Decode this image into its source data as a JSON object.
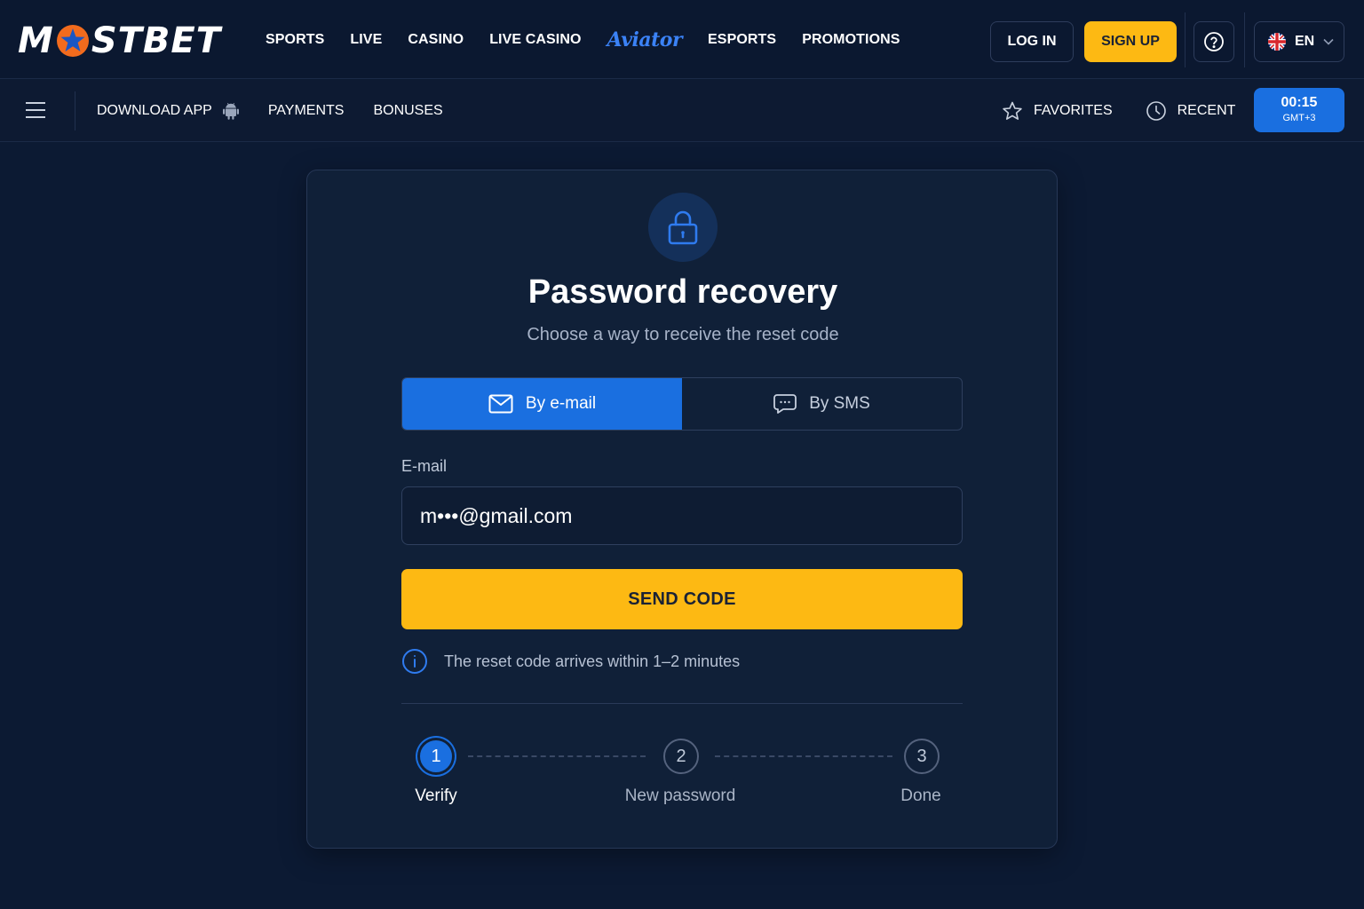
{
  "header": {
    "logo": {
      "part1": "M",
      "part2": "STBET"
    },
    "nav": [
      "SPORTS",
      "LIVE",
      "CASINO",
      "LIVE CASINO",
      "Aviator",
      "ESPORTS",
      "PROMOTIONS"
    ],
    "login_label": "LOG IN",
    "signup_label": "SIGN UP",
    "help_icon": "question-circle-icon",
    "language": "EN"
  },
  "subbar": {
    "download_label": "DOWNLOAD APP",
    "payments_label": "PAYMENTS",
    "bonuses_label": "BONUSES",
    "favorites_label": "FAVORITES",
    "recent_label": "RECENT",
    "clock": {
      "time": "00:15",
      "zone": "GMT+3"
    }
  },
  "recovery": {
    "title": "Password recovery",
    "subtitle": "Choose a way to receive the reset code",
    "tabs": [
      {
        "label": "By e-mail",
        "icon": "mail-icon",
        "active": true
      },
      {
        "label": "By SMS",
        "icon": "chat-icon",
        "active": false
      }
    ],
    "field_label": "E-mail",
    "email_value": "m•••@gmail.com",
    "send_label": "SEND CODE",
    "hint": "The reset code arrives within 1–2 minutes",
    "steps": [
      {
        "num": "1",
        "label": "Verify",
        "active": true
      },
      {
        "num": "2",
        "label": "New password",
        "active": false
      },
      {
        "num": "3",
        "label": "Done",
        "active": false
      }
    ]
  },
  "colors": {
    "accent_blue": "#1a6fe0",
    "accent_yellow": "#fdb913",
    "background": "#0c1a33",
    "logo_orange": "#f26b1d"
  }
}
